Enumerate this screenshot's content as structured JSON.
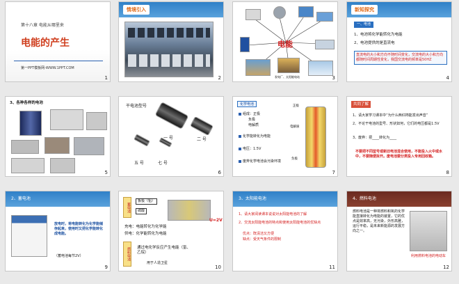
{
  "slides": [
    {
      "num": "1",
      "chapter": "第十八章 电能从哪里来",
      "title": "电能的产生",
      "footer": "第一PPT模板网-WWW.1PPT.COM"
    },
    {
      "num": "2",
      "title": "情境引入"
    },
    {
      "num": "3",
      "center": "电能",
      "caption": "发电厂、太阳能电站"
    },
    {
      "num": "4",
      "title": "新知探究",
      "subtitle": "一、电池",
      "p1": "1、电池将化学能转化为电能",
      "p2": "2、电池提供的是直流电",
      "box": "直流电的大小和方向不随时间变化，交流电的大小和方向都随时间周期性变化，我国交流电的频率是50HZ"
    },
    {
      "num": "5",
      "title": "3、各种各样的电池"
    },
    {
      "num": "6",
      "title": "干电池型号",
      "l1": "一 号",
      "l2": "二 号",
      "l3": "五 号",
      "l4": "七 号"
    },
    {
      "num": "7",
      "tag": "化学电池",
      "i1": "组成：正极",
      "i1b": "负极",
      "i1c": "电解质",
      "i2": "化学能转化为电能",
      "i3": "电压：1.5V",
      "i4": "废弃化学电池会污染环境",
      "lab1": "正极",
      "lab2": "电解质",
      "lab3": "负极"
    },
    {
      "num": "8",
      "title": "共同了解",
      "p1": "1、请大家学习课本中“为什么西红柿能发出声音”",
      "p2": "2、不论干电池的型号、形状如何，它们的电压都是1.5V",
      "p3": "3、废弃：把____转化为____",
      "warn": "不要把不同型号或新旧电池混合使用，不能投入火中或水中，不要随便拆开。废电池要分类投入专用回收箱。"
    },
    {
      "num": "9",
      "title": "2、蓄电池",
      "desc": "放电时，将电能转化为化学能储存起来，使用时又把化学能转化成电能。",
      "note": "（蓄电池每节2V）"
    },
    {
      "num": "10",
      "v1": "蓄电池",
      "v2": "燃料电池",
      "k1": "板极（铅）",
      "k2": "硫酸",
      "c1": "充电：电能转化为化学能",
      "c2": "供电：化学能转化为电能",
      "fuel": "通过电化学反应产生电能（氢、乙烷）",
      "sat": "用于人造卫星",
      "volt": "U=2V"
    },
    {
      "num": "11",
      "title": "3、太阳能电池",
      "p1": "1、请大家阅读课本说说对太阳能电池的了解",
      "p2": "2、交流太阳能电池的特点和使用太阳能电池的优缺点",
      "p3": "优点：既清洁又方便",
      "p4": "缺点：受天气条件的限制"
    },
    {
      "num": "12",
      "title": "4、燃料电池",
      "body": "燃料电池是一种将燃料和氧的化学能直接转化为电能的装置，它的优点是效率高，无污染，外形高雅，运行平稳，是未来新能源的发展方向之一。",
      "cap": "利用燃料电池的电动车"
    }
  ]
}
